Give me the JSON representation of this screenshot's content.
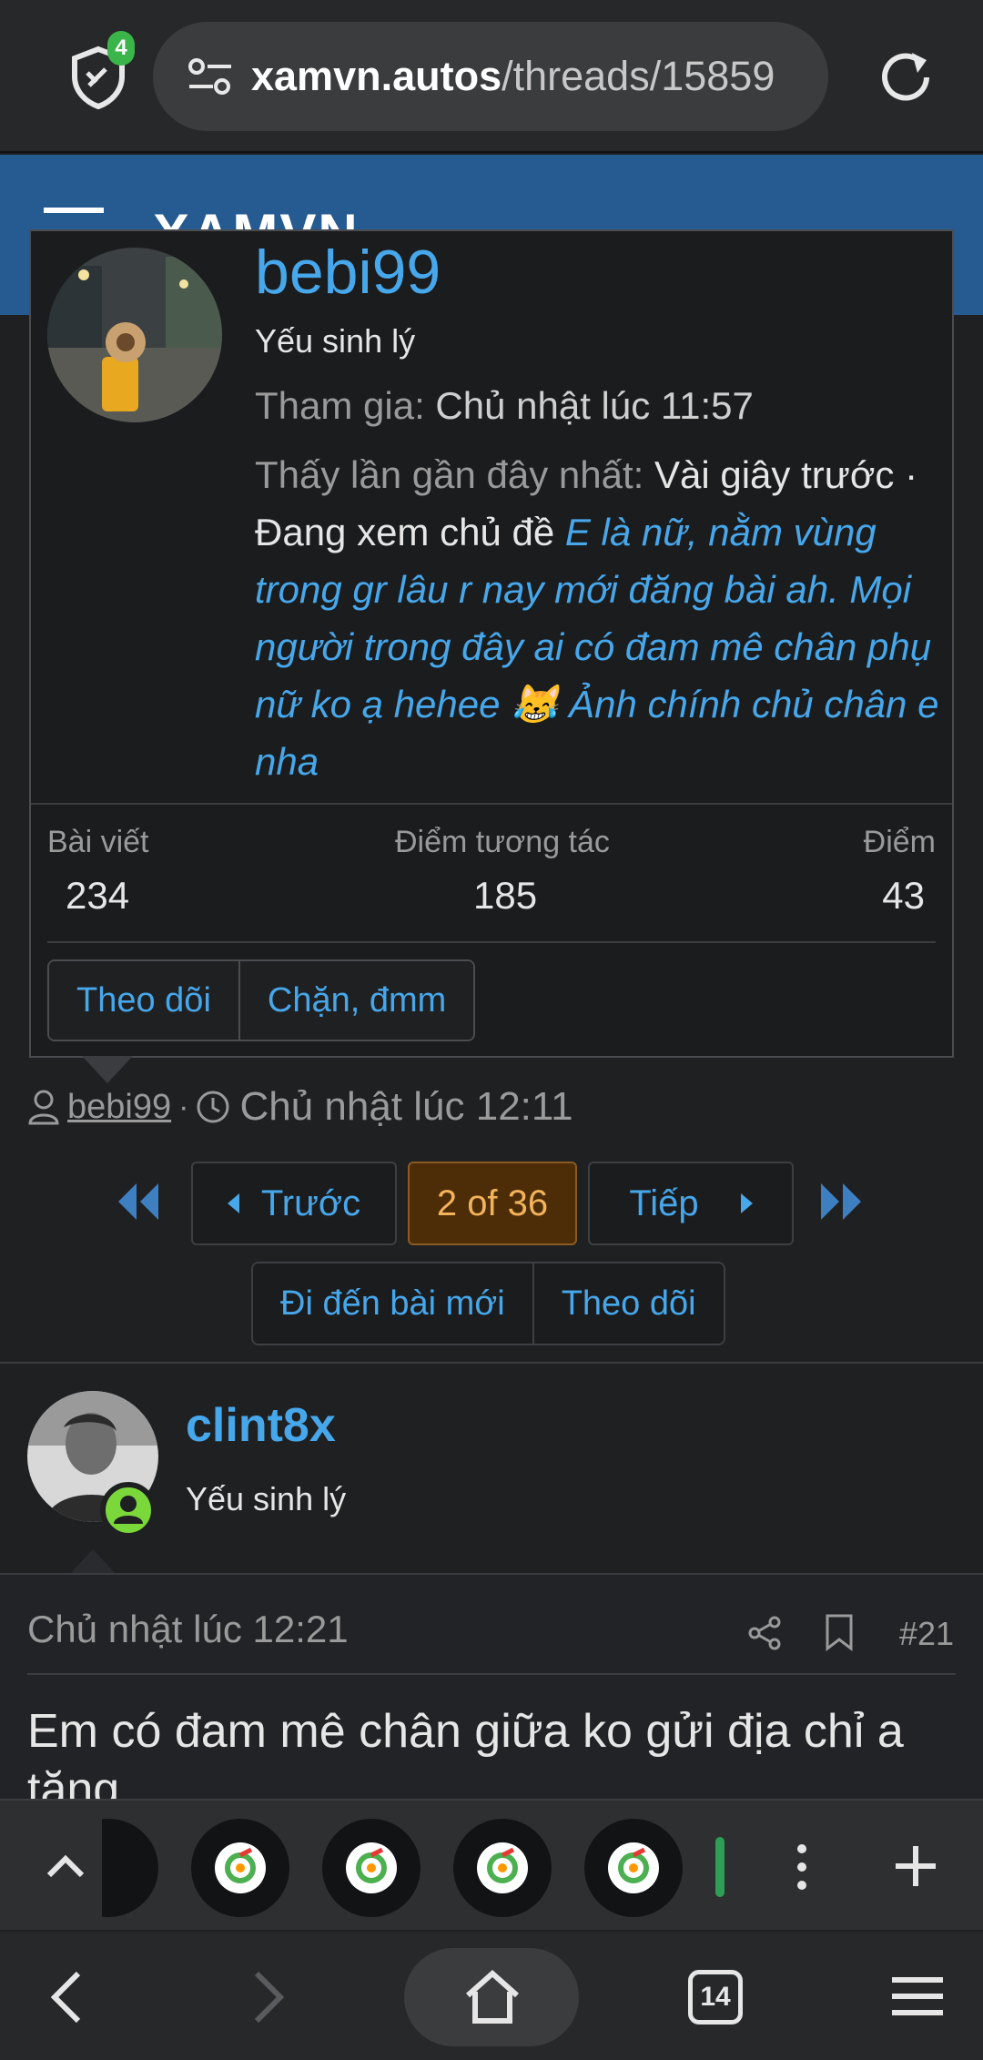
{
  "browser": {
    "shield_badge": "4",
    "url_domain": "xamvn.autos",
    "url_path": "/threads/15859",
    "tab_count": "14"
  },
  "site": {
    "logo": "XAMVN"
  },
  "tooltip": {
    "username": "bebi99",
    "user_title": "Yếu sinh lý",
    "joined_label": "Tham gia:",
    "joined_value": "Chủ nhật lúc 11:57",
    "last_seen_label": "Thấy lần gần đây nhất:",
    "last_seen_value": "Vài giây trước",
    "activity_prefix": "· Đang xem chủ đề",
    "activity_thread": "E là nữ, nằm vùng trong gr lâu r nay mới đăng bài ah. Mọi người trong đây ai có đam mê chân phụ nữ ko ạ hehee 😹 Ảnh chính chủ chân e nha",
    "stats": [
      {
        "label": "Bài viết",
        "value": "234"
      },
      {
        "label": "Điểm tương tác",
        "value": "185"
      },
      {
        "label": "Điểm",
        "value": "43"
      }
    ],
    "follow_label": "Theo dõi",
    "block_label": "Chặn, đmm"
  },
  "thread_meta": {
    "author": "bebi99",
    "separator": "·",
    "time": "Chủ nhật lúc 12:11"
  },
  "pagination": {
    "prev_label": "Trước",
    "current": "2 of 36",
    "next_label": "Tiếp",
    "goto_new_label": "Đi đến bài mới",
    "watch_label": "Theo dõi"
  },
  "post": {
    "username": "clint8x",
    "user_title": "Yếu sinh lý",
    "date": "Chủ nhật lúc 12:21",
    "number": "#21",
    "text": "Em có đam mê chân giữa ko gửi địa chỉ a tặng"
  },
  "colors": {
    "accent": "#47a7eb",
    "header_blue": "#255b91",
    "current_page_bg": "#4d2d08",
    "current_page_text": "#f3b35b",
    "online_green": "#7bd83a",
    "background": "#1f2022"
  }
}
